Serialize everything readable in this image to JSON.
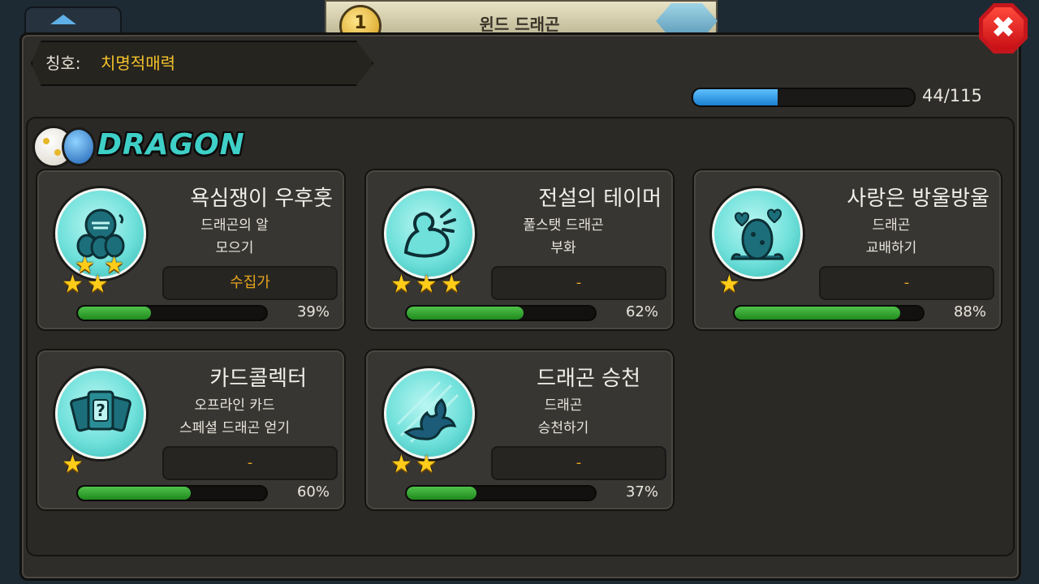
{
  "background": {
    "title": "윈드 드래곤",
    "coin_value": "1"
  },
  "close_label": "✖",
  "title_plate": {
    "label": "칭호:",
    "value": "치명적매력"
  },
  "overall_progress": {
    "text": "44/115",
    "current": 44,
    "total": 115
  },
  "section": {
    "title": "DRAGON"
  },
  "cards": [
    {
      "title": "욕심쟁이 우후훗",
      "desc1": "드래곤의 알",
      "desc2": "모으기",
      "reward": "수집가",
      "percent_text": "39%",
      "percent": 39,
      "stars": 4,
      "icon": "dragon-eggs-icon"
    },
    {
      "title": "전설의 테이머",
      "desc1": "풀스탯 드래곤",
      "desc2": "부화",
      "reward": "-",
      "percent_text": "62%",
      "percent": 62,
      "stars": 3,
      "icon": "muscle-arm-icon"
    },
    {
      "title": "사랑은 방울방울",
      "desc1": "드래곤",
      "desc2": "교배하기",
      "reward": "-",
      "percent_text": "88%",
      "percent": 88,
      "stars": 1,
      "icon": "egg-hearts-icon"
    },
    {
      "title": "카드콜렉터",
      "desc1": "오프라인 카드",
      "desc2": "스페셜 드래곤 얻기",
      "reward": "-",
      "percent_text": "60%",
      "percent": 60,
      "stars": 1,
      "icon": "mystery-cards-icon"
    },
    {
      "title": "드래곤 승천",
      "desc1": "드래곤",
      "desc2": "승천하기",
      "reward": "-",
      "percent_text": "37%",
      "percent": 37,
      "stars": 2,
      "icon": "ascending-dragon-icon"
    }
  ]
}
